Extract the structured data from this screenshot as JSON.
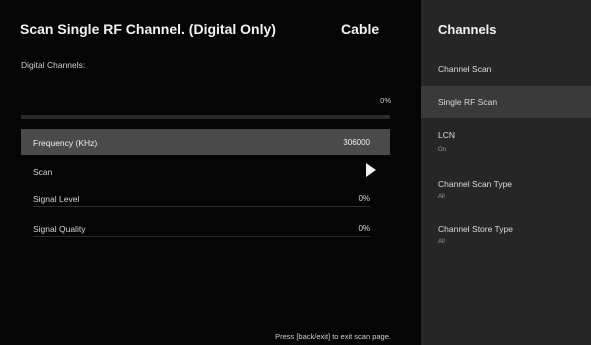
{
  "scan_panel": {
    "title": "Scan Single RF Channel. (Digital Only)",
    "source": "Cable",
    "digital_channels_label": "Digital Channels:",
    "progress_text": "0%",
    "progress_fraction": 0,
    "rows": {
      "frequency": {
        "label": "Frequency (KHz)",
        "value": "306000"
      },
      "scan": {
        "label": "Scan"
      },
      "signal_level": {
        "label": "Signal Level",
        "value": "0%"
      },
      "signal_quality": {
        "label": "Signal Quality",
        "value": "0%"
      }
    },
    "footer_hint": "Press [back/exit] to exit scan page."
  },
  "channels_menu": {
    "title": "Channels",
    "items": [
      {
        "label": "Channel Scan"
      },
      {
        "label": "Single RF Scan",
        "selected": true
      },
      {
        "label": "LCN",
        "sub": "On"
      },
      {
        "label": "Channel Scan Type",
        "sub": "All"
      },
      {
        "label": "Channel Store Type",
        "sub": "All"
      }
    ]
  },
  "colors": {
    "selected_row": "#4a4a4a",
    "menu_background": "#262626",
    "menu_selected": "#3a3a3a"
  }
}
